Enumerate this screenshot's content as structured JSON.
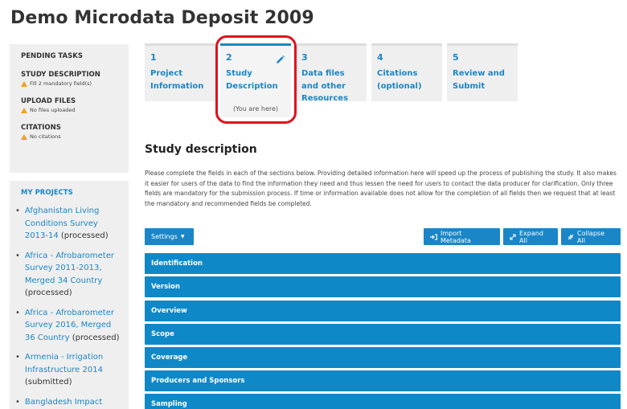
{
  "page_title": "Demo Microdata Deposit 2009",
  "pending": {
    "heading": "PENDING TASKS",
    "tasks": [
      {
        "title": "STUDY DESCRIPTION",
        "note": "Fill 2 mandatory field(s)"
      },
      {
        "title": "UPLOAD FILES",
        "note": "No files uploaded"
      },
      {
        "title": "CITATIONS",
        "note": "No citations"
      }
    ]
  },
  "projects": {
    "heading": "MY PROJECTS",
    "items": [
      {
        "name": "Afghanistan Living Conditions Survey 2013-14",
        "status": "(processed)"
      },
      {
        "name": "Africa - Afrobarometer Survey 2011-2013, Merged 34 Country",
        "status": "(processed)"
      },
      {
        "name": "Africa - Afrobarometer Survey 2016, Merged 36 Country",
        "status": "(processed)"
      },
      {
        "name": "Armenia - Irrigation Infrastructure 2014",
        "status": "(submitted)"
      },
      {
        "name": "Bangladesh Impact",
        "status": ""
      }
    ]
  },
  "steps": [
    {
      "num": "1",
      "label_line1": "Project",
      "label_line2": "Information",
      "label_line3": ""
    },
    {
      "num": "2",
      "label_line1": "Study",
      "label_line2": "Description",
      "label_line3": "",
      "note": "(You are here)"
    },
    {
      "num": "3",
      "label_line1": "Data files",
      "label_line2": "and other",
      "label_line3": "Resources"
    },
    {
      "num": "4",
      "label_line1": "Citations",
      "label_line2": "(optional)",
      "label_line3": ""
    },
    {
      "num": "5",
      "label_line1": "Review and",
      "label_line2": "Submit",
      "label_line3": ""
    }
  ],
  "section": {
    "title": "Study description",
    "intro": "Please complete the fields in each of the sections below. Providing detailed information here will speed up the process of publishing the study. It also makes it easier for users of the data to find the information they need and thus lessen the need for users to contact the data producer for clarification. Only three fields are mandatory for the submission process. If time or information available does not allow for the completion of all fields then we request that at least the mandatory and recommended fields be completed."
  },
  "toolbar": {
    "settings": "Settings",
    "import": "Import Metadata",
    "expand": "Expand All",
    "collapse": "Collapse All"
  },
  "accordion": [
    "Identification",
    "Version",
    "Overview",
    "Scope",
    "Coverage",
    "Producers and Sponsors",
    "Sampling"
  ],
  "colors": {
    "accent": "#1a86c7",
    "accordion": "#0f88c8",
    "highlight": "#e0121e",
    "warning": "#f0a020"
  }
}
